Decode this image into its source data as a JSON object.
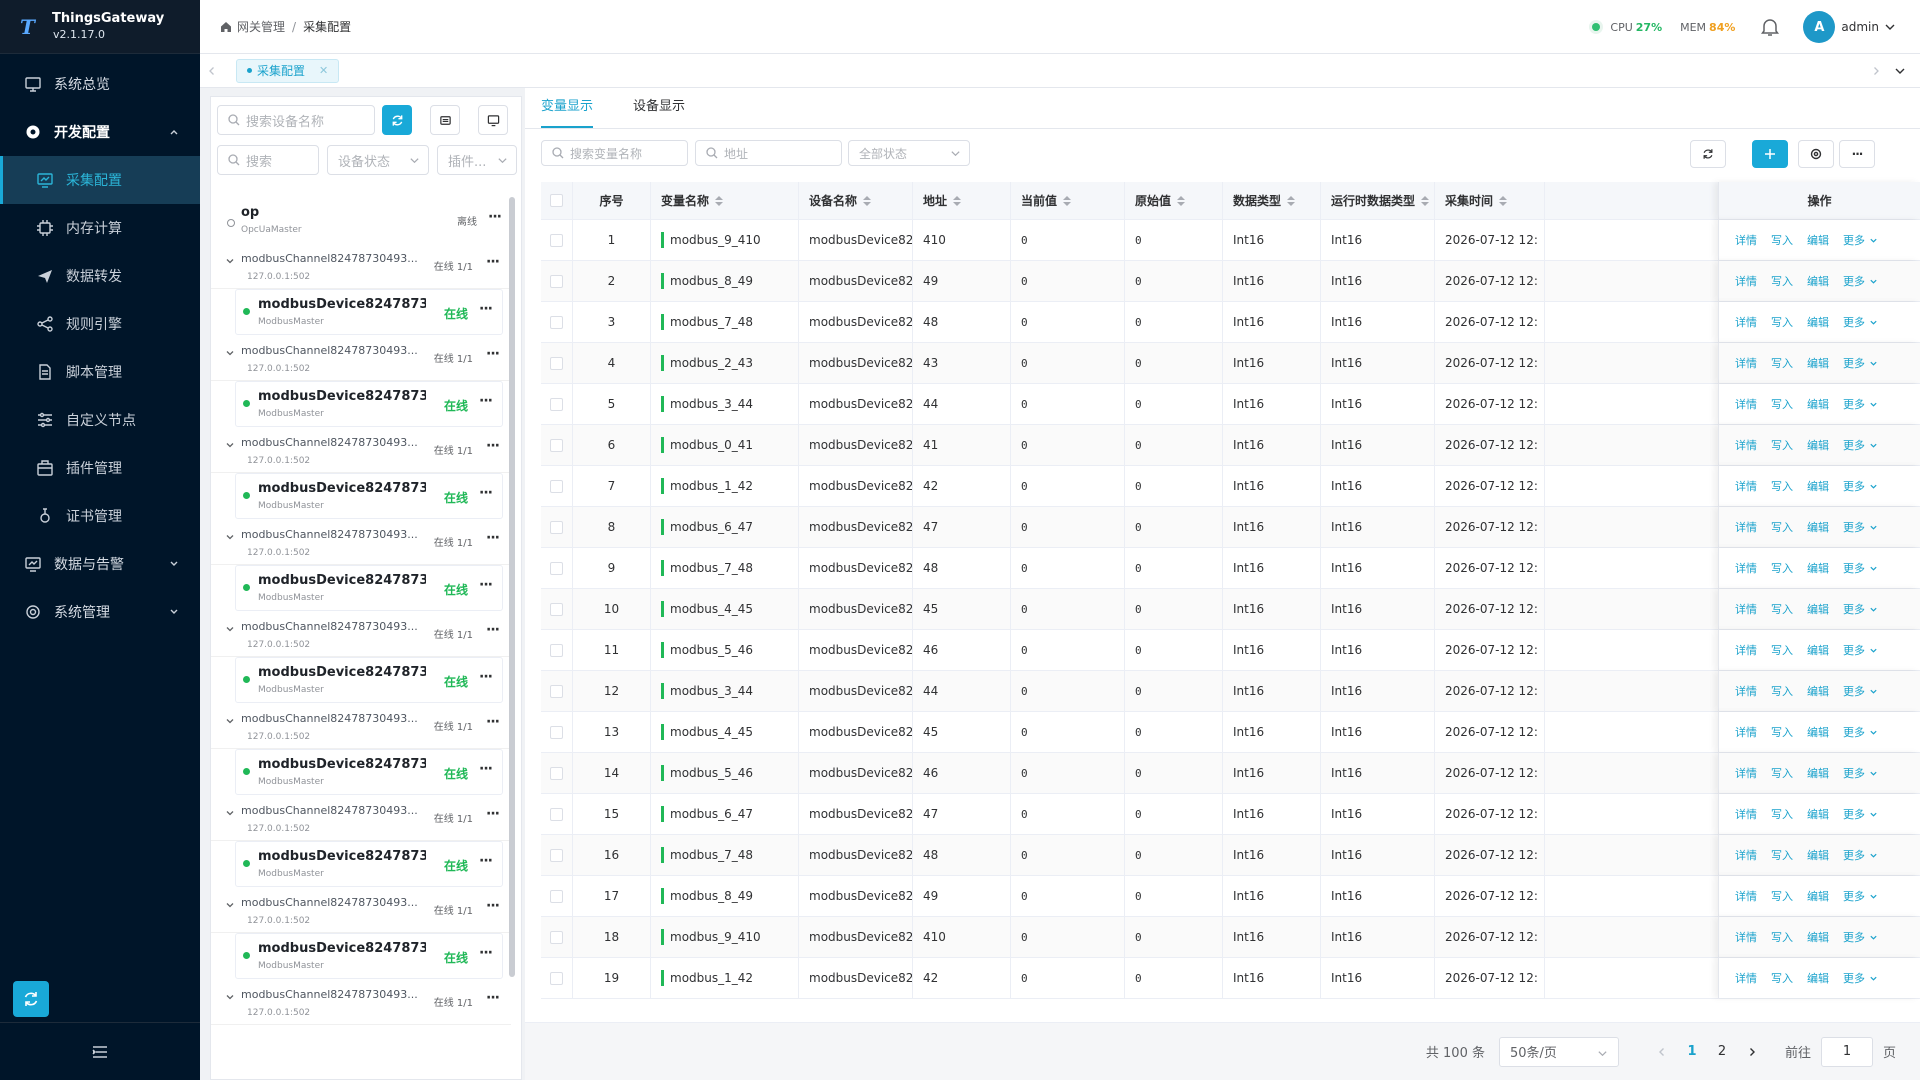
{
  "app": {
    "name": "ThingsGateway",
    "version": "v2.1.17.0"
  },
  "sidebar": {
    "items": [
      {
        "label": "系统总览"
      },
      {
        "label": "开发配置"
      },
      {
        "label": "采集配置"
      },
      {
        "label": "内存计算"
      },
      {
        "label": "数据转发"
      },
      {
        "label": "规则引擎"
      },
      {
        "label": "脚本管理"
      },
      {
        "label": "自定义节点"
      },
      {
        "label": "插件管理"
      },
      {
        "label": "证书管理"
      },
      {
        "label": "数据与告警"
      },
      {
        "label": "系统管理"
      }
    ]
  },
  "header": {
    "breadcrumb": [
      "网关管理",
      "/",
      "采集配置"
    ],
    "cpu_label": "CPU",
    "cpu_value": "27%",
    "mem_label": "MEM",
    "mem_value": "84%",
    "avatar_letter": "A",
    "user": "admin"
  },
  "tabs": [
    {
      "label": "采集配置"
    }
  ],
  "left": {
    "search_device_placeholder": "搜索设备名称",
    "search_placeholder": "搜索",
    "status_placeholder": "设备状态",
    "plugin_placeholder": "插件...",
    "root": {
      "name": "op",
      "plugin": "OpcUaMaster",
      "status": "离线"
    },
    "channels": [
      {
        "name": "modbusChannel82478730493...",
        "addr": "127.0.0.1:502",
        "status": "在线 1/1",
        "device": "modbusDevice82478730...",
        "plugin": "ModbusMaster",
        "dstatus": "在线"
      },
      {
        "name": "modbusChannel82478730493...",
        "addr": "127.0.0.1:502",
        "status": "在线 1/1",
        "device": "modbusDevice82478730...",
        "plugin": "ModbusMaster",
        "dstatus": "在线"
      },
      {
        "name": "modbusChannel82478730493...",
        "addr": "127.0.0.1:502",
        "status": "在线 1/1",
        "device": "modbusDevice82478730...",
        "plugin": "ModbusMaster",
        "dstatus": "在线"
      },
      {
        "name": "modbusChannel82478730493...",
        "addr": "127.0.0.1:502",
        "status": "在线 1/1",
        "device": "modbusDevice82478730...",
        "plugin": "ModbusMaster",
        "dstatus": "在线"
      },
      {
        "name": "modbusChannel82478730493...",
        "addr": "127.0.0.1:502",
        "status": "在线 1/1",
        "device": "modbusDevice82478730...",
        "plugin": "ModbusMaster",
        "dstatus": "在线"
      },
      {
        "name": "modbusChannel82478730493...",
        "addr": "127.0.0.1:502",
        "status": "在线 1/1",
        "device": "modbusDevice82478730...",
        "plugin": "ModbusMaster",
        "dstatus": "在线"
      },
      {
        "name": "modbusChannel82478730493...",
        "addr": "127.0.0.1:502",
        "status": "在线 1/1",
        "device": "modbusDevice82478730...",
        "plugin": "ModbusMaster",
        "dstatus": "在线"
      },
      {
        "name": "modbusChannel82478730493...",
        "addr": "127.0.0.1:502",
        "status": "在线 1/1",
        "device": "modbusDevice82478730...",
        "plugin": "ModbusMaster",
        "dstatus": "在线"
      },
      {
        "name": "modbusChannel82478730493...",
        "addr": "127.0.0.1:502",
        "status": "在线 1/1"
      }
    ]
  },
  "right": {
    "tabs": [
      "变量显示",
      "设备显示"
    ],
    "search_var_placeholder": "搜索变量名称",
    "addr_placeholder": "地址",
    "state_placeholder": "全部状态",
    "columns": [
      "序号",
      "变量名称",
      "设备名称",
      "地址",
      "当前值",
      "原始值",
      "数据类型",
      "运行时数据类型",
      "采集时间",
      "操作"
    ],
    "ops": [
      "详情",
      "写入",
      "编辑",
      "更多"
    ],
    "rows": [
      {
        "idx": "1",
        "name": "modbus_9_410",
        "device": "modbusDevice82...",
        "addr": "410",
        "cur": "0",
        "raw": "0",
        "dtype": "Int16",
        "rtype": "Int16",
        "time": "2026-07-12 12:"
      },
      {
        "idx": "2",
        "name": "modbus_8_49",
        "device": "modbusDevice82...",
        "addr": "49",
        "cur": "0",
        "raw": "0",
        "dtype": "Int16",
        "rtype": "Int16",
        "time": "2026-07-12 12:"
      },
      {
        "idx": "3",
        "name": "modbus_7_48",
        "device": "modbusDevice82...",
        "addr": "48",
        "cur": "0",
        "raw": "0",
        "dtype": "Int16",
        "rtype": "Int16",
        "time": "2026-07-12 12:"
      },
      {
        "idx": "4",
        "name": "modbus_2_43",
        "device": "modbusDevice82...",
        "addr": "43",
        "cur": "0",
        "raw": "0",
        "dtype": "Int16",
        "rtype": "Int16",
        "time": "2026-07-12 12:"
      },
      {
        "idx": "5",
        "name": "modbus_3_44",
        "device": "modbusDevice82...",
        "addr": "44",
        "cur": "0",
        "raw": "0",
        "dtype": "Int16",
        "rtype": "Int16",
        "time": "2026-07-12 12:"
      },
      {
        "idx": "6",
        "name": "modbus_0_41",
        "device": "modbusDevice82...",
        "addr": "41",
        "cur": "0",
        "raw": "0",
        "dtype": "Int16",
        "rtype": "Int16",
        "time": "2026-07-12 12:"
      },
      {
        "idx": "7",
        "name": "modbus_1_42",
        "device": "modbusDevice82...",
        "addr": "42",
        "cur": "0",
        "raw": "0",
        "dtype": "Int16",
        "rtype": "Int16",
        "time": "2026-07-12 12:"
      },
      {
        "idx": "8",
        "name": "modbus_6_47",
        "device": "modbusDevice82...",
        "addr": "47",
        "cur": "0",
        "raw": "0",
        "dtype": "Int16",
        "rtype": "Int16",
        "time": "2026-07-12 12:"
      },
      {
        "idx": "9",
        "name": "modbus_7_48",
        "device": "modbusDevice82...",
        "addr": "48",
        "cur": "0",
        "raw": "0",
        "dtype": "Int16",
        "rtype": "Int16",
        "time": "2026-07-12 12:"
      },
      {
        "idx": "10",
        "name": "modbus_4_45",
        "device": "modbusDevice82...",
        "addr": "45",
        "cur": "0",
        "raw": "0",
        "dtype": "Int16",
        "rtype": "Int16",
        "time": "2026-07-12 12:"
      },
      {
        "idx": "11",
        "name": "modbus_5_46",
        "device": "modbusDevice82...",
        "addr": "46",
        "cur": "0",
        "raw": "0",
        "dtype": "Int16",
        "rtype": "Int16",
        "time": "2026-07-12 12:"
      },
      {
        "idx": "12",
        "name": "modbus_3_44",
        "device": "modbusDevice82...",
        "addr": "44",
        "cur": "0",
        "raw": "0",
        "dtype": "Int16",
        "rtype": "Int16",
        "time": "2026-07-12 12:"
      },
      {
        "idx": "13",
        "name": "modbus_4_45",
        "device": "modbusDevice82...",
        "addr": "45",
        "cur": "0",
        "raw": "0",
        "dtype": "Int16",
        "rtype": "Int16",
        "time": "2026-07-12 12:"
      },
      {
        "idx": "14",
        "name": "modbus_5_46",
        "device": "modbusDevice82...",
        "addr": "46",
        "cur": "0",
        "raw": "0",
        "dtype": "Int16",
        "rtype": "Int16",
        "time": "2026-07-12 12:"
      },
      {
        "idx": "15",
        "name": "modbus_6_47",
        "device": "modbusDevice82...",
        "addr": "47",
        "cur": "0",
        "raw": "0",
        "dtype": "Int16",
        "rtype": "Int16",
        "time": "2026-07-12 12:"
      },
      {
        "idx": "16",
        "name": "modbus_7_48",
        "device": "modbusDevice82...",
        "addr": "48",
        "cur": "0",
        "raw": "0",
        "dtype": "Int16",
        "rtype": "Int16",
        "time": "2026-07-12 12:"
      },
      {
        "idx": "17",
        "name": "modbus_8_49",
        "device": "modbusDevice82...",
        "addr": "49",
        "cur": "0",
        "raw": "0",
        "dtype": "Int16",
        "rtype": "Int16",
        "time": "2026-07-12 12:"
      },
      {
        "idx": "18",
        "name": "modbus_9_410",
        "device": "modbusDevice82...",
        "addr": "410",
        "cur": "0",
        "raw": "0",
        "dtype": "Int16",
        "rtype": "Int16",
        "time": "2026-07-12 12:"
      },
      {
        "idx": "19",
        "name": "modbus_1_42",
        "device": "modbusDevice82...",
        "addr": "42",
        "cur": "0",
        "raw": "0",
        "dtype": "Int16",
        "rtype": "Int16",
        "time": "2026-07-12 12:"
      }
    ]
  },
  "pagination": {
    "total": "共 100 条",
    "page_size": "50条/页",
    "pages": [
      "1",
      "2"
    ],
    "goto_label": "前往",
    "goto_value": "1",
    "page_suffix": "页"
  },
  "colors": {
    "accent": "#19a9d8",
    "sidebar_bg": "#001529",
    "online": "#20b857",
    "mem_warn": "#f0a020"
  }
}
